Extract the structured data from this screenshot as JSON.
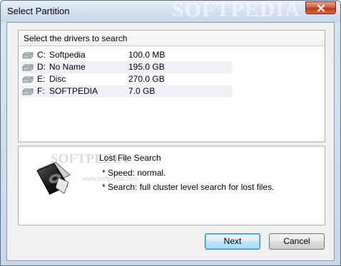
{
  "window": {
    "title": "Select Partition",
    "watermark": "SOFTPEDIA"
  },
  "drives_panel": {
    "header": "Select the drivers to search",
    "drives": [
      {
        "letter": "C:",
        "name": "Softpedia",
        "size": "100.0 MB"
      },
      {
        "letter": "D:",
        "name": "No Name",
        "size": "195.0 GB"
      },
      {
        "letter": "E:",
        "name": "Disc",
        "size": "270.0 GB"
      },
      {
        "letter": "F:",
        "name": "SOFTPEDIA",
        "size": "7.0 GB"
      }
    ]
  },
  "search_panel": {
    "title": "Lost File Search",
    "speed": "* Speed: normal.",
    "description": "* Search: full cluster level search for lost files.",
    "watermark": "SOFTPEDIA",
    "watermark_url": "www.softpedia.com"
  },
  "buttons": {
    "next": "Next",
    "cancel": "Cancel"
  },
  "icons": {
    "close": "close-icon",
    "drive": "hard-drive-icon",
    "disk": "disk-icon"
  }
}
